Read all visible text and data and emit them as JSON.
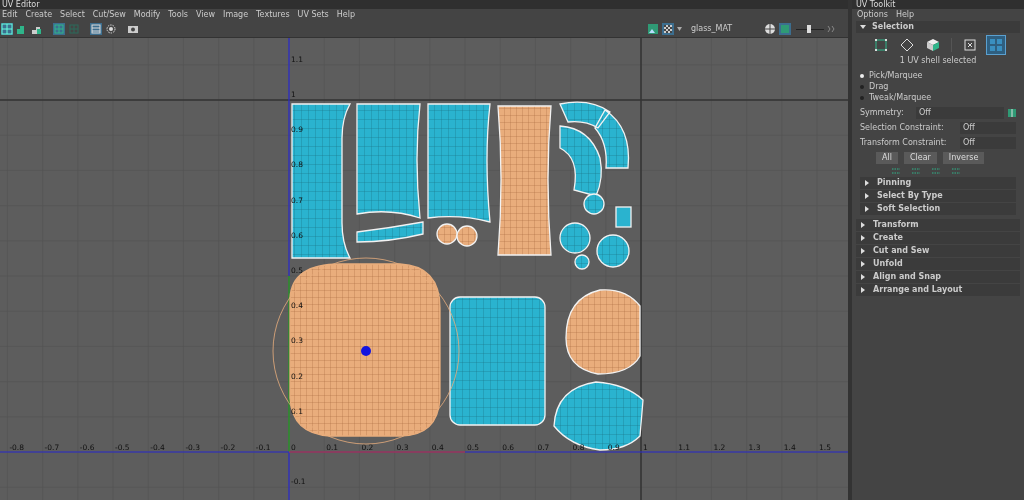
{
  "uv_editor": {
    "title": "UV Editor",
    "menu": [
      "Edit",
      "Create",
      "Select",
      "Cut/Sew",
      "Modify",
      "Tools",
      "View",
      "Image",
      "Textures",
      "UV Sets",
      "Help"
    ],
    "toolbar": {
      "material": "glass_MAT",
      "exposure": {
        "level": 0.45
      }
    },
    "canvas": {
      "u_labels": [
        "-0.8",
        "-0.7",
        "-0.6",
        "-0.5",
        "-0.4",
        "-0.3",
        "-0.2",
        "-0.1",
        "0",
        "0.1",
        "0.2",
        "0.3",
        "0.4",
        "0.5",
        "0.6",
        "0.7",
        "0.8",
        "0.9",
        "1",
        "1.1",
        "1.2",
        "1.3",
        "1.4",
        "1.5"
      ],
      "v_labels": [
        "1.1",
        "1",
        "0.9",
        "0.8",
        "0.7",
        "0.6",
        "0.5",
        "0.4",
        "0.3",
        "0.2",
        "0.1",
        "-0.1"
      ]
    }
  },
  "uv_toolkit": {
    "title": "UV Toolkit",
    "menu": [
      "Options",
      "Help"
    ],
    "selection": {
      "title": "Selection",
      "expanded": true,
      "types": [
        {
          "kind": "vertex",
          "selected": false
        },
        {
          "kind": "edge",
          "selected": false
        },
        {
          "kind": "face",
          "selected": false
        },
        {
          "kind": "uv",
          "selected": false
        },
        {
          "kind": "shell",
          "selected": true
        }
      ],
      "status": "1 UV shell selected",
      "modes": [
        {
          "label": "Pick/Marquee",
          "selected": true
        },
        {
          "label": "Drag",
          "selected": false
        },
        {
          "label": "Tweak/Marquee",
          "selected": false
        }
      ],
      "symmetry": {
        "label": "Symmetry:",
        "value": "Off"
      },
      "constraints": [
        {
          "label": "Selection Constraint:",
          "value": "Off"
        },
        {
          "label": "Transform Constraint:",
          "value": "Off"
        }
      ],
      "buttons": [
        "All",
        "Clear",
        "Inverse"
      ],
      "subsections": [
        {
          "title": "Pinning",
          "expanded": false
        },
        {
          "title": "Select By Type",
          "expanded": false
        },
        {
          "title": "Soft Selection",
          "expanded": false
        }
      ]
    },
    "sections": [
      {
        "title": "Transform",
        "expanded": false
      },
      {
        "title": "Create",
        "expanded": false
      },
      {
        "title": "Cut and Sew",
        "expanded": false
      },
      {
        "title": "Unfold",
        "expanded": false
      },
      {
        "title": "Align and Snap",
        "expanded": false
      },
      {
        "title": "Arrange and Layout",
        "expanded": false
      }
    ]
  }
}
